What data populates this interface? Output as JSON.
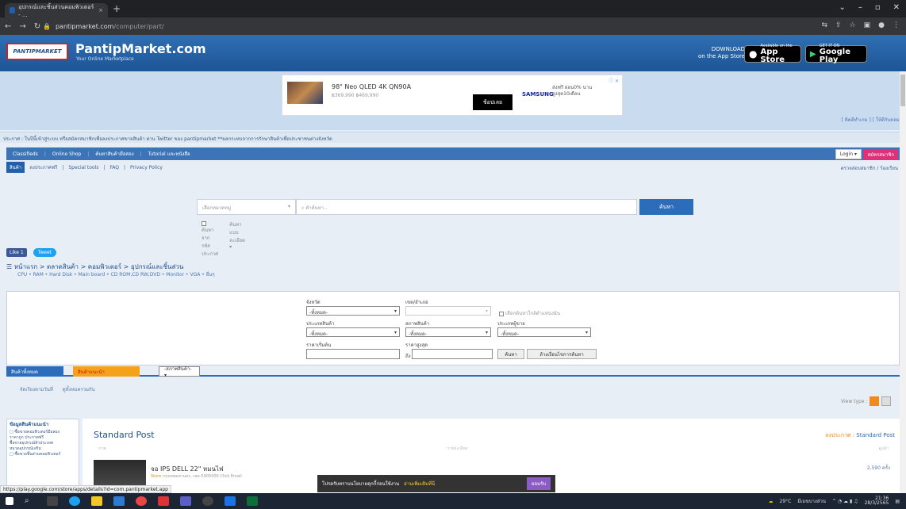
{
  "browser": {
    "tab_title": "อุปกรณ์และชิ้นส่วนคอมพิวเตอร์ - ...",
    "tab_close": "×",
    "new_tab": "+",
    "url_host": "pantipmarket.com",
    "url_path": "/computer/part/"
  },
  "header": {
    "logo_text": "PANTIPMARKET",
    "brand": "PantipMarket.com",
    "tagline": "Your Online Marketplace",
    "download_line1": "DOWNLOAD",
    "download_line2": "on the App Store",
    "appstore_small": "Available on the",
    "appstore_big": "App Store",
    "googleplay_small": "GET IT ON",
    "googleplay_big": "Google Play"
  },
  "ad": {
    "title": "98\" Neo QLED 4K QN90A",
    "price": "฿369,990 ฿469,990",
    "button": "ช้อปเลย",
    "brand": "SAMSUNG",
    "side_text": "ส่งฟรี ผ่อน0% นาน สูงสุด10เดือน",
    "close": "ⓘ ✕"
  },
  "side_links": "[ คิดดีทำเกม ] [ ให้ดีกับคอม ]",
  "info_bar": "ประกาศ : ในปีนี้เข้าสู่ระบบ หรือสมัครสมาชิกเพื่อลงประกาศขายสินค้า ผ่าน Twitter ของ pantipmarket **ผลกระทบจากการรักษาสินค้าเพื่อประชาชนต่างจังหวัด",
  "main_nav": {
    "items": [
      "Classifieds",
      "Online Shop",
      "ค้นหาสินค้ามือสอง",
      "Tutorial และหนังสือ"
    ],
    "login": "Login ▾",
    "register": "สมัครสมาชิก"
  },
  "sub_nav": {
    "active": "สินค้า",
    "items": [
      "ลงประกาศฟรี",
      "Special tools",
      "FAQ",
      "Privacy Policy"
    ],
    "right": "ตรวจสอบสมาชิก / ร้องเรียน"
  },
  "search": {
    "category_placeholder": "เลือกหมวดหมู่",
    "input_placeholder": "คำค้นหา...",
    "button": "ค้นหา",
    "opt1": "ค้นหาจากรหัสประกาศ",
    "opt2": "ค้นหาแบบละเอียด ▾"
  },
  "social": {
    "fb": "Like 1",
    "tw": "Tweet"
  },
  "breadcrumb": "หน้าแรก > ตลาดสินค้า > คอมพิวเตอร์ > อุปกรณ์และชิ้นส่วน",
  "subcats": "CPU • RAM • Hard Disk • Main board • CD ROM,CD RW,DVD • Monitor • VGA • อื่นๆ",
  "filter": {
    "province_label": "จังหวัด",
    "province_value": "-ทั้งหมด-",
    "district_label": "เขต/อำเภอ",
    "near_label": "เลือกค้นหาใกล้ตำแหน่งฉัน",
    "type_label": "ประเภทสินค้า",
    "type_value": "-ทั้งหมด-",
    "condition_label": "สภาพสินค้า",
    "condition_value": "-ทั้งหมด-",
    "post_type_label": "ประเภทผู้ขาย",
    "post_type_value": "-ทั้งหมด-",
    "price_min_label": "ราคาเริ่มต้น",
    "price_max_label": "ราคาสูงสุด",
    "to": "ถึง",
    "search_button": "ค้นหา",
    "reset_button": "ล้างเงื่อนไขการค้นหา"
  },
  "tabs": {
    "tab1": "สินค้าทั้งหมด",
    "tab2": "สินค้าแนะนำ",
    "tab3": "-สภาพสินค้า- ▾"
  },
  "sort": [
    "จัดเรียงตามวันที่",
    "ดูทั้งหมดรวมกัน"
  ],
  "view_type": "View type :",
  "sidebox": {
    "title": "ข้อมูลสินค้าแนะนำ",
    "lines": [
      "□ ซื้อขายคอมพิวเตอร์มือสอง",
      "ราคาถูก ประกาศฟรี",
      "ซื้อขายอุปกรณ์ทั่วประเทศ",
      "หมวดอุปกรณ์เสริม",
      "□ ซื้อขายชิ้นส่วนคอมพิวเตอร์"
    ]
  },
  "content": {
    "title": "Standard Post",
    "right_label": "ลงประกาศ :",
    "right_value": "Standard Post",
    "col1": "ภาพ",
    "col2": "รายละเอียด",
    "col3": "ดูแล้ว",
    "post_title": "จอ IPS DELL 22\" หมนไฟ",
    "post_meta_store": "Store",
    "post_meta": "กรุงเทพมหานคร, เขต-5905000 Click Email",
    "post_views": "2,590 ครั้ง"
  },
  "cookie": {
    "text": "โปรดรับทราบนโยบายคุกกี้ก่อนใช้งาน",
    "link": "อ่านเพิ่มเติมที่นี่",
    "ok": "ยอมรับ"
  },
  "status_url": "https://play.google.com/store/apps/details?id=com.pantipmarket.app",
  "tray": {
    "weather": "29°C",
    "weather_text": "มีเมฆบางส่วน",
    "time": "21:36",
    "date": "28/3/2565"
  }
}
